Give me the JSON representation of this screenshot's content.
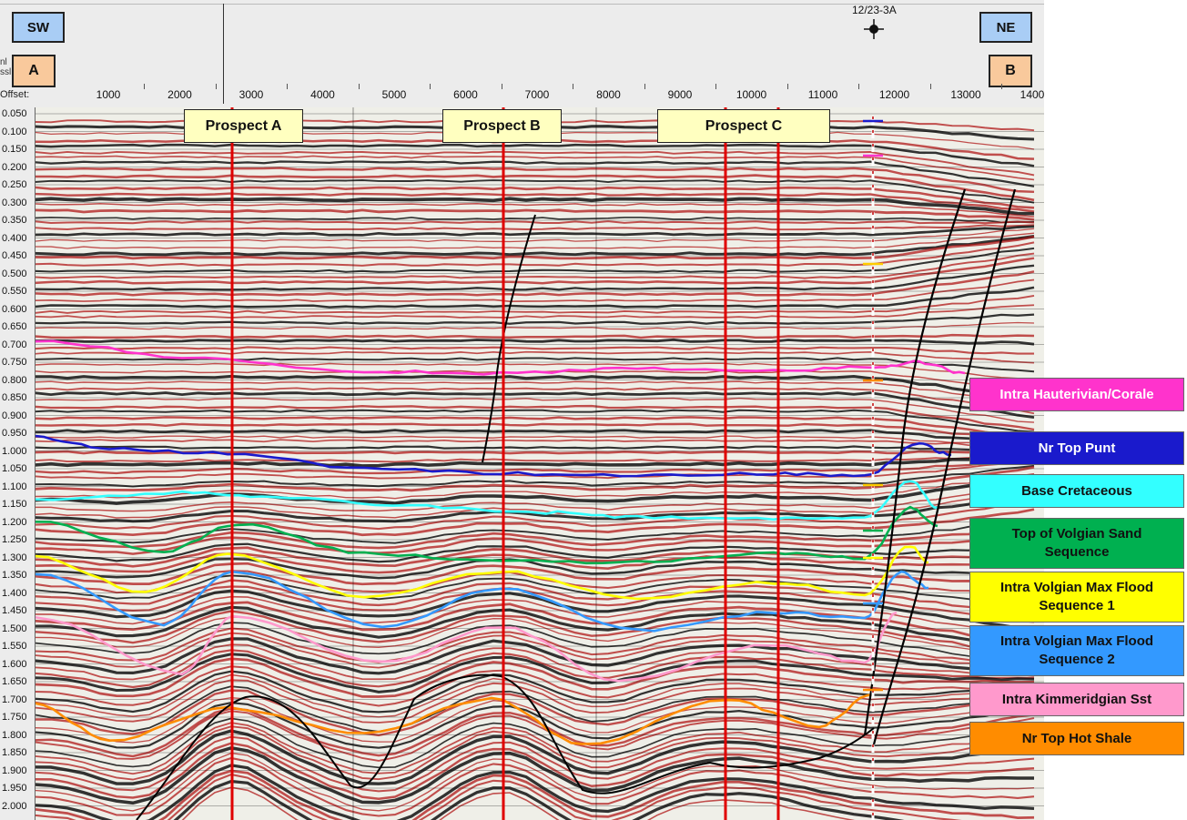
{
  "header": {
    "left_direction": "SW",
    "right_direction": "NE",
    "left_endpoint": "A",
    "right_endpoint": "B",
    "offset_label": "Offset:",
    "side_labels": [
      "nl",
      "ssl"
    ],
    "offset_ticks": [
      "1000",
      "2000",
      "3000",
      "4000",
      "5000",
      "6000",
      "7000",
      "8000",
      "9000",
      "10000",
      "11000",
      "12000",
      "13000",
      "1400"
    ],
    "well_name": "12/23-3A",
    "well_icon": "well-symbol-icon"
  },
  "time_axis": {
    "labels": [
      "0.050",
      "0.100",
      "0.150",
      "0.200",
      "0.250",
      "0.300",
      "0.350",
      "0.400",
      "0.450",
      "0.500",
      "0.550",
      "0.600",
      "0.650",
      "0.700",
      "0.750",
      "0.800",
      "0.850",
      "0.900",
      "0.950",
      "1.000",
      "1.050",
      "1.100",
      "1.150",
      "1.200",
      "1.250",
      "1.300",
      "1.350",
      "1.400",
      "1.450",
      "1.500",
      "1.550",
      "1.600",
      "1.650",
      "1.700",
      "1.750",
      "1.800",
      "1.850",
      "1.900",
      "1.950",
      "2.000"
    ]
  },
  "prospects": [
    "Prospect A",
    "Prospect B",
    "Prospect C"
  ],
  "horizons": [
    {
      "name": "Intra Hauterivian/Corale",
      "color": "#ff33cc",
      "text_color": "#ffffff"
    },
    {
      "name": "Nr Top Punt",
      "color": "#1a1acc",
      "text_color": "#ffffff"
    },
    {
      "name": "Base Cretaceous",
      "color": "#33ffff",
      "text_color": "#111111"
    },
    {
      "name": "Top of Volgian  Sand Sequence",
      "color": "#00b050",
      "text_color": "#111111"
    },
    {
      "name": "Intra Volgian Max Flood Sequence 1",
      "color": "#ffff00",
      "text_color": "#111111"
    },
    {
      "name": "Intra Volgian Max Flood Sequence 2",
      "color": "#3399ff",
      "text_color": "#111111"
    },
    {
      "name": "Intra Kimmeridgian  Sst",
      "color": "#ff99cc",
      "text_color": "#111111"
    },
    {
      "name": "Nr Top Hot Shale",
      "color": "#ff8c00",
      "text_color": "#111111"
    }
  ],
  "colors": {
    "trace_red": "#b01818",
    "trace_black": "#111111",
    "well_line": "#ffffff",
    "prospect_line": "#e00000"
  }
}
